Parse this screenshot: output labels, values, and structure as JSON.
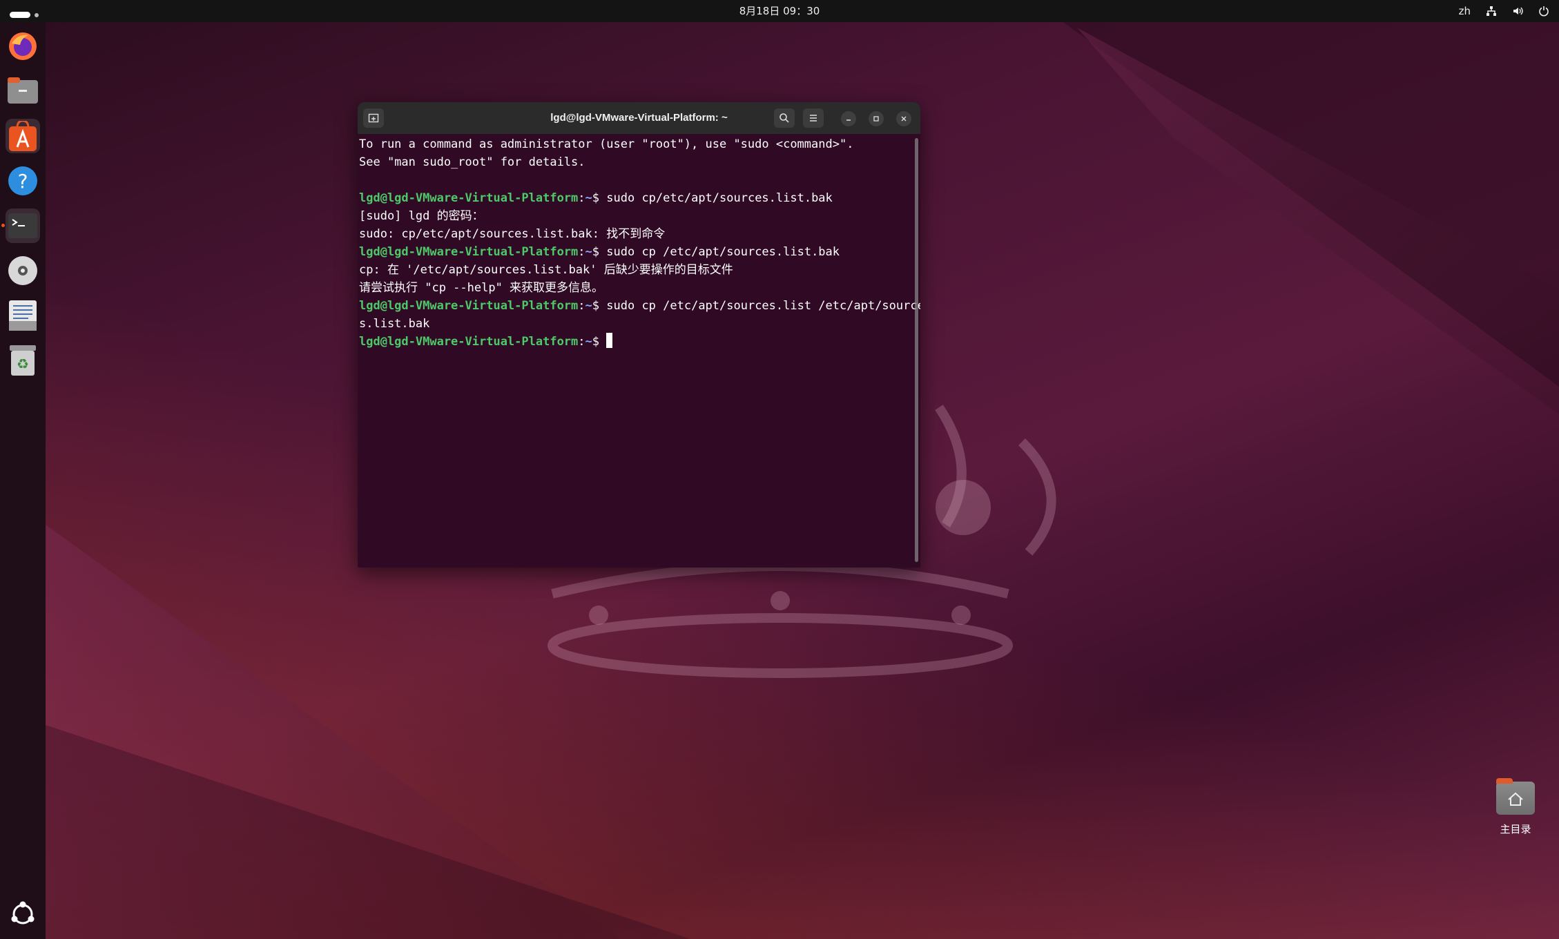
{
  "topbar": {
    "clock": "8月18日 09：30",
    "input_method": "zh",
    "icons": [
      "network-icon",
      "volume-icon",
      "power-icon"
    ]
  },
  "dock": {
    "items": [
      "firefox-icon",
      "files-icon",
      "app-center-icon",
      "help-icon",
      "terminal-icon",
      "disc-icon",
      "text-editor-icon",
      "trash-icon"
    ],
    "bottom": "ubuntu-apps-icon"
  },
  "terminal": {
    "title": "lgd@lgd-VMware-Virtual-Platform: ~",
    "prompt_user_host": "lgd@lgd-VMware-Virtual-Platform",
    "prompt_path": "~",
    "lines": {
      "l1": "To run a command as administrator (user \"root\"), use \"sudo <command>\".",
      "l2": "See \"man sudo_root\" for details.",
      "c1": "sudo cp/etc/apt/sources.list.bak",
      "o1": "[sudo] lgd 的密码：",
      "o2": "sudo: cp/etc/apt/sources.list.bak: 找不到命令",
      "c2": "sudo cp /etc/apt/sources.list.bak",
      "o3": "cp: 在 '/etc/apt/sources.list.bak' 后缺少要操作的目标文件",
      "o4": "请尝试执行 \"cp --help\" 来获取更多信息。",
      "c3a": "sudo cp /etc/apt/sources.list /etc/apt/source",
      "c3b": "s.list.bak"
    }
  },
  "desktop": {
    "home_label": "主目录"
  },
  "colors": {
    "terminal_bg": "#300a24",
    "prompt_green": "#4ec96a",
    "accent_orange": "#e95420"
  }
}
